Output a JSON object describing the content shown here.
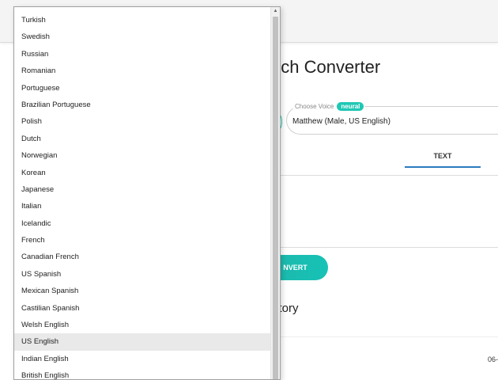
{
  "page": {
    "title_partial": "ech Converter",
    "voice_label": "Choose Voice",
    "neural_badge": "neural",
    "voice_value": "Matthew (Male, US English)",
    "tab_text": "TEXT",
    "convert_partial": "NVERT",
    "history_partial": "story",
    "row_snippet": "06-"
  },
  "dropdown": {
    "selected": "US English",
    "options": [
      "Turkish",
      "Swedish",
      "Russian",
      "Romanian",
      "Portuguese",
      "Brazilian Portuguese",
      "Polish",
      "Dutch",
      "Norwegian",
      "Korean",
      "Japanese",
      "Italian",
      "Icelandic",
      "French",
      "Canadian French",
      "US Spanish",
      "Mexican Spanish",
      "Castilian Spanish",
      "Welsh English",
      "US English",
      "Indian English",
      "British English"
    ],
    "scroll_up_icon": "chevron-up-icon"
  },
  "colors": {
    "accent": "#1ec8b4",
    "tab_underline": "#2a7bc0"
  }
}
